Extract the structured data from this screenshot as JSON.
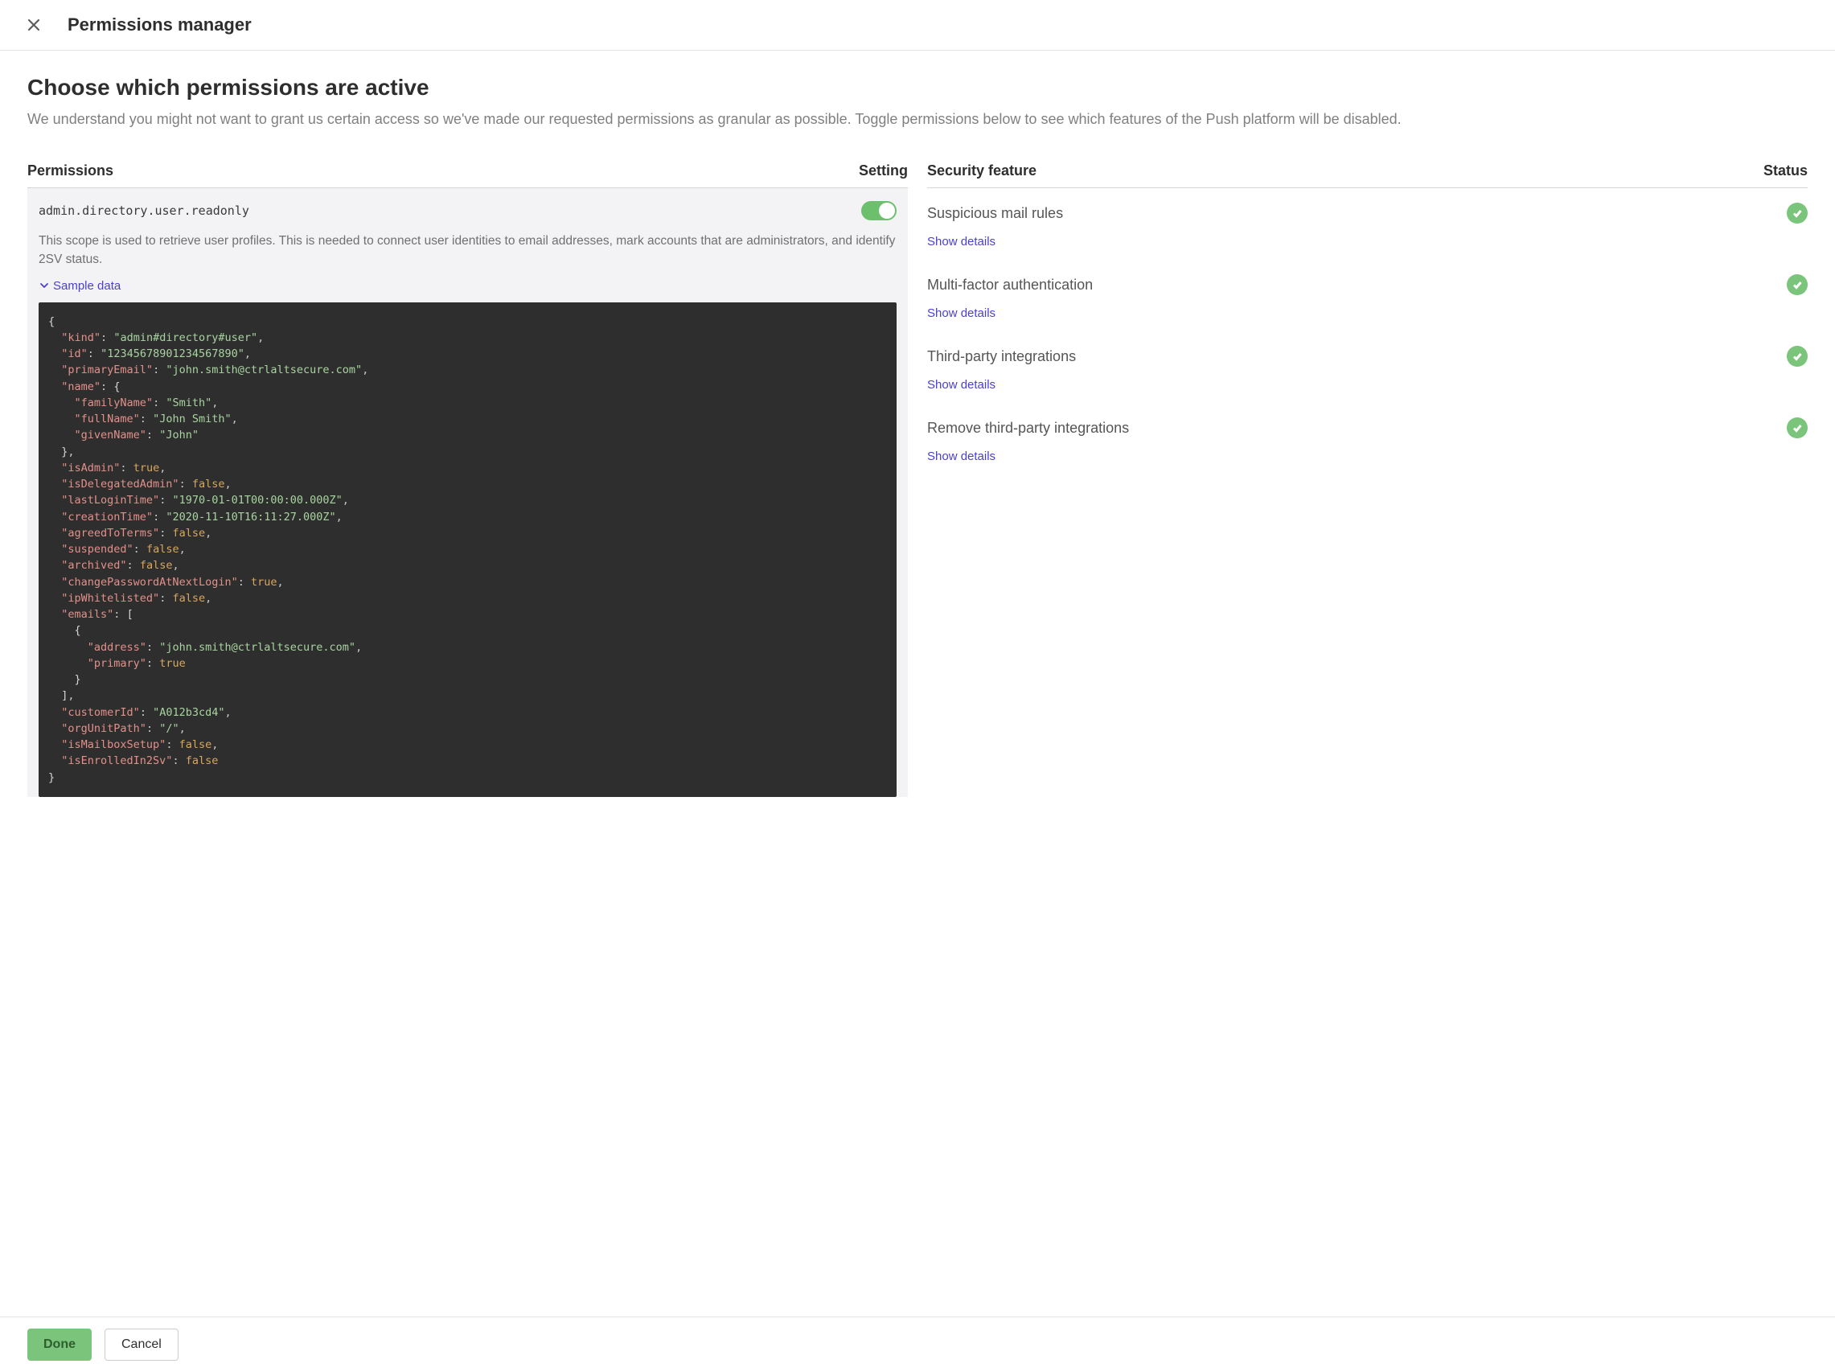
{
  "header": {
    "title": "Permissions manager"
  },
  "main": {
    "heading": "Choose which permissions are active",
    "description": "We understand you might not want to grant us certain access so we've made our requested permissions as granular as possible. Toggle permissions below to see which features of the Push platform will be disabled."
  },
  "left": {
    "title": "Permissions",
    "setting_label": "Setting",
    "permission": {
      "scope": "admin.directory.user.readonly",
      "toggle_on": true,
      "description": "This scope is used to retrieve user profiles. This is needed to connect user identities to email addresses, mark accounts that are administrators, and identify 2SV status.",
      "sample_label": "Sample data",
      "sample_json": {
        "kind": "admin#directory#user",
        "id": "12345678901234567890",
        "primaryEmail": "john.smith@ctrlaltsecure.com",
        "name": {
          "familyName": "Smith",
          "fullName": "John Smith",
          "givenName": "John"
        },
        "isAdmin": true,
        "isDelegatedAdmin": false,
        "lastLoginTime": "1970-01-01T00:00:00.000Z",
        "creationTime": "2020-11-10T16:11:27.000Z",
        "agreedToTerms": false,
        "suspended": false,
        "archived": false,
        "changePasswordAtNextLogin": true,
        "ipWhitelisted": false,
        "emails": [
          {
            "address": "john.smith@ctrlaltsecure.com",
            "primary": true
          }
        ],
        "customerId": "A012b3cd4",
        "orgUnitPath": "/",
        "isMailboxSetup": false,
        "isEnrolledIn2Sv": false
      }
    }
  },
  "right": {
    "title": "Security feature",
    "status_label": "Status",
    "show_details": "Show details",
    "features": [
      {
        "name": "Suspicious mail rules",
        "status": "ok"
      },
      {
        "name": "Multi-factor authentication",
        "status": "ok"
      },
      {
        "name": "Third-party integrations",
        "status": "ok"
      },
      {
        "name": "Remove third-party integrations",
        "status": "ok"
      }
    ]
  },
  "footer": {
    "done": "Done",
    "cancel": "Cancel"
  }
}
